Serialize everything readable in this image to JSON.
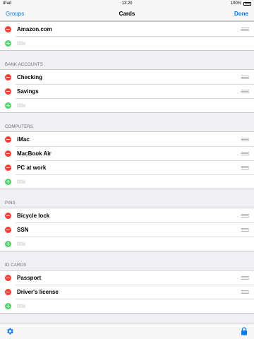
{
  "status_bar": {
    "carrier": "iPad",
    "time": "13:20",
    "battery": "100%"
  },
  "nav": {
    "back_label": "Groups",
    "title": "Cards",
    "done_label": "Done"
  },
  "top_group": {
    "items": [
      "Amazon.com"
    ],
    "add_placeholder": "title"
  },
  "sections": [
    {
      "header": "BANK ACCOUNTS",
      "items": [
        "Checking",
        "Savings"
      ],
      "add_placeholder": "title"
    },
    {
      "header": "COMPUTERS",
      "items": [
        "iMac",
        "MacBook Air",
        "PC at work"
      ],
      "add_placeholder": "title"
    },
    {
      "header": "PINS",
      "items": [
        "Bicycle lock",
        "SSN"
      ],
      "add_placeholder": "title"
    },
    {
      "header": "ID CARDS",
      "items": [
        "Passport",
        "Driver's license"
      ],
      "add_placeholder": "title"
    }
  ],
  "toolbar": {
    "left_icon": "gear-icon",
    "right_icon": "lock-icon"
  },
  "colors": {
    "accent": "#007aff",
    "delete": "#ff3b30",
    "add": "#4cd964",
    "background": "#efeff4"
  }
}
